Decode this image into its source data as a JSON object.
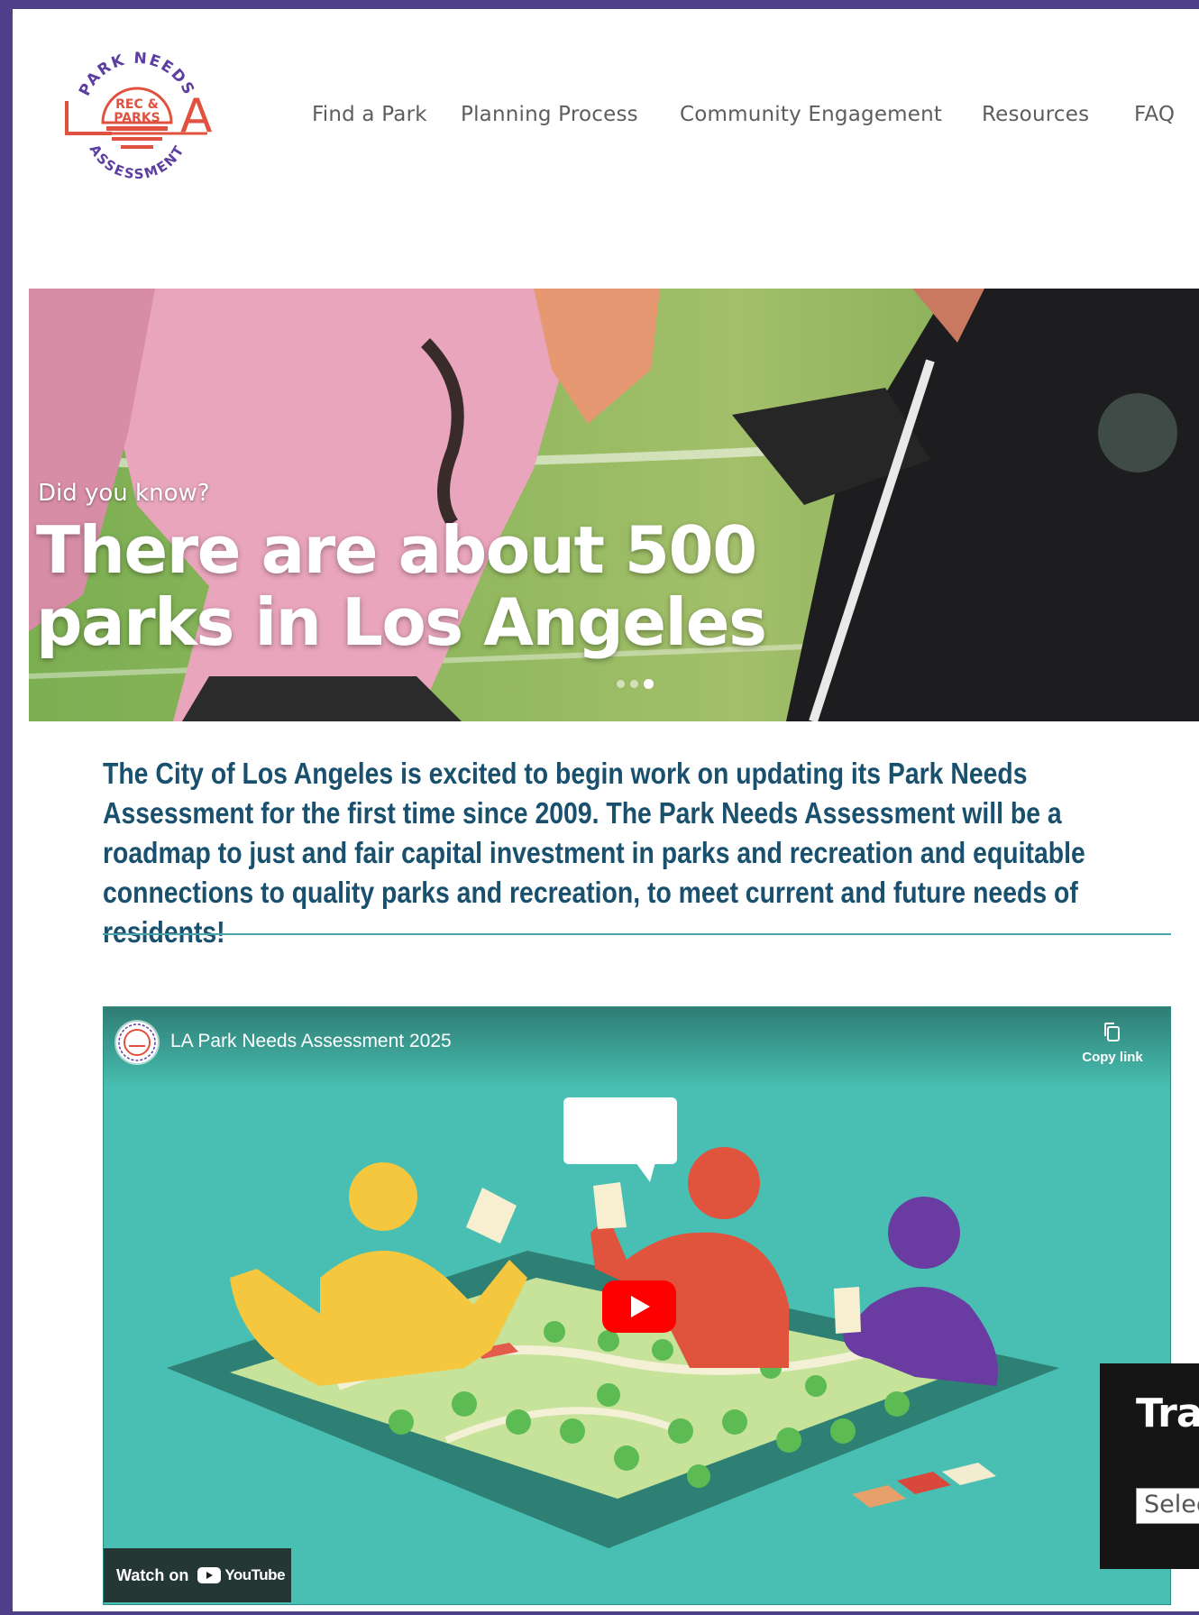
{
  "header": {
    "logo": {
      "top_text": "PARK NEEDS",
      "inner_text": [
        "REC &",
        "PARKS"
      ],
      "bottom_text": "ASSESSMENT",
      "side_letters": [
        "L",
        "A"
      ]
    },
    "nav": [
      {
        "label": "Find a Park"
      },
      {
        "label": "Planning Process"
      },
      {
        "label": "Community Engagement"
      },
      {
        "label": "Resources"
      },
      {
        "label": "FAQ"
      }
    ]
  },
  "hero": {
    "kicker": "Did you know?",
    "headline": "There are about 500 parks in Los Angeles",
    "slides": 3,
    "active_slide": 3
  },
  "intro": {
    "text": "The City of Los Angeles is excited to begin work on updating its Park Needs Assessment for the first time since 2009. The Park Needs Assessment will be a roadmap to just and fair capital investment in parks and recreation and equitable connections to quality parks and recreation, to meet current and future needs of residents!"
  },
  "video": {
    "title": "LA Park Needs Assessment 2025",
    "copy_link_label": "Copy link",
    "watch_on_label": "Watch on",
    "youtube_label": "YouTube"
  },
  "translate": {
    "title": "Trar",
    "select_placeholder": "Select"
  },
  "colors": {
    "frame": "#4d3f8a",
    "logo_red": "#e0523f",
    "logo_purple": "#5c3ea0",
    "intro_text": "#19506e",
    "rule": "#4aa5ad",
    "video_bg": "#48bfb2"
  }
}
